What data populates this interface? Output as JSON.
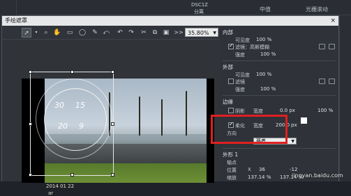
{
  "background_app": {
    "top_node_label": "DSC1Z",
    "top_sub_label": "分离",
    "top_tabs": [
      "中值",
      "光栅滚动"
    ]
  },
  "dialog": {
    "title": "手绘遮罩",
    "close_glyph": "×"
  },
  "toolbar": {
    "zoom_value": "35.80%",
    "zoom_prefix": ">>"
  },
  "canvas": {
    "date_stamp": "2014 01 22",
    "date_stamp_sub": "ar",
    "dial_text": [
      "30",
      "15",
      "20",
      "9"
    ]
  },
  "properties": {
    "inner": {
      "title": "内部",
      "opacity_label": "可见度",
      "opacity_value": "100 %",
      "filter_label": "滤镜：高斯模糊",
      "filter_checked": true,
      "strength_label": "强度",
      "strength_value": "100 %"
    },
    "outer": {
      "title": "外部",
      "opacity_label": "可见度",
      "opacity_value": "100 %",
      "filter_label": "滤镜",
      "filter_checked": false,
      "strength_label": "强度",
      "strength_value": "100 %"
    },
    "edge": {
      "title": "边缘",
      "shadow_label": "阴影",
      "shadow_checked": false,
      "width_label": "宽度",
      "width_value": "0.0 px",
      "right_percent": "100 %",
      "soften_label": "柔化",
      "soften_checked": true,
      "soften_width_label": "宽度",
      "soften_width_value": "200.0",
      "soften_unit": "px",
      "direction_label": "方向",
      "direction_value": "两者"
    },
    "shape": {
      "title": "外形 1",
      "pivot_label": "轴点",
      "position_label": "位置",
      "position_x": "X",
      "position_x_value": "36",
      "position_y_value": "-12",
      "scale_label": "缩放",
      "scale_x_value": "137.14 %",
      "scale_y_value": "137.14 %"
    }
  },
  "watermark": "jingyan.baidu.com",
  "colors": {
    "highlight": "#e02020",
    "title_bar": "#e6e7e9"
  }
}
